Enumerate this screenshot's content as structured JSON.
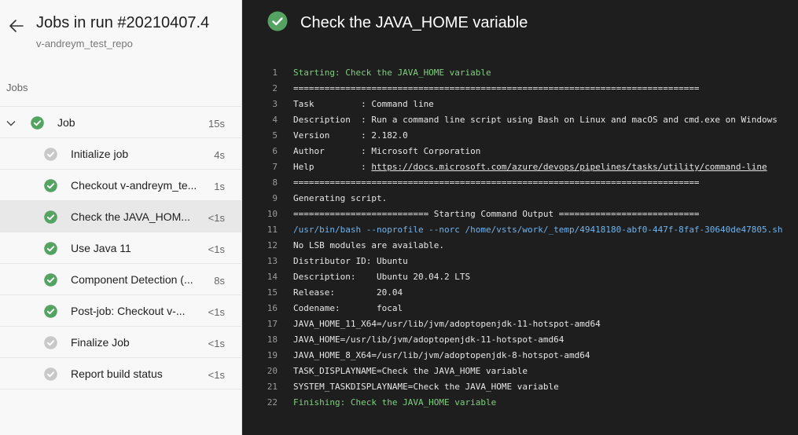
{
  "left_panel": {
    "title": "Jobs in run #20210407.4",
    "repo": "v-andreym_test_repo",
    "section_label": "Jobs",
    "job": {
      "label": "Job",
      "duration": "15s",
      "status": "success"
    },
    "steps": [
      {
        "label": "Initialize job",
        "duration": "4s",
        "status": "skipped"
      },
      {
        "label": "Checkout v-andreym_te...",
        "duration": "1s",
        "status": "success"
      },
      {
        "label": "Check the JAVA_HOM...",
        "duration": "<1s",
        "status": "success",
        "selected": true
      },
      {
        "label": "Use Java 11",
        "duration": "<1s",
        "status": "success"
      },
      {
        "label": "Component Detection (...",
        "duration": "8s",
        "status": "success"
      },
      {
        "label": "Post-job: Checkout v-...",
        "duration": "<1s",
        "status": "success"
      },
      {
        "label": "Finalize Job",
        "duration": "<1s",
        "status": "skipped"
      },
      {
        "label": "Report build status",
        "duration": "<1s",
        "status": "skipped"
      }
    ]
  },
  "log_panel": {
    "title": "Check the JAVA_HOME variable",
    "lines": [
      {
        "n": "1",
        "text": "Starting: Check the JAVA_HOME variable",
        "style": "green"
      },
      {
        "n": "2",
        "text": "==============================================================================",
        "style": ""
      },
      {
        "n": "3",
        "text": "Task         : Command line",
        "style": ""
      },
      {
        "n": "4",
        "text": "Description  : Run a command line script using Bash on Linux and macOS and cmd.exe on Windows",
        "style": ""
      },
      {
        "n": "5",
        "text": "Version      : 2.182.0",
        "style": ""
      },
      {
        "n": "6",
        "text": "Author       : Microsoft Corporation",
        "style": ""
      },
      {
        "n": "7",
        "prefix": "Help         : ",
        "link": "https://docs.microsoft.com/azure/devops/pipelines/tasks/utility/command-line",
        "style": ""
      },
      {
        "n": "8",
        "text": "==============================================================================",
        "style": ""
      },
      {
        "n": "9",
        "text": "Generating script.",
        "style": ""
      },
      {
        "n": "10",
        "text": "========================== Starting Command Output ===========================",
        "style": ""
      },
      {
        "n": "11",
        "text": "/usr/bin/bash --noprofile --norc /home/vsts/work/_temp/49418180-abf0-447f-8faf-30640de47805.sh",
        "style": "blue"
      },
      {
        "n": "12",
        "text": "No LSB modules are available.",
        "style": ""
      },
      {
        "n": "13",
        "text": "Distributor ID: Ubuntu",
        "style": ""
      },
      {
        "n": "14",
        "text": "Description:    Ubuntu 20.04.2 LTS",
        "style": ""
      },
      {
        "n": "15",
        "text": "Release:        20.04",
        "style": ""
      },
      {
        "n": "16",
        "text": "Codename:       focal",
        "style": ""
      },
      {
        "n": "17",
        "text": "JAVA_HOME_11_X64=/usr/lib/jvm/adoptopenjdk-11-hotspot-amd64",
        "style": ""
      },
      {
        "n": "18",
        "text": "JAVA_HOME=/usr/lib/jvm/adoptopenjdk-11-hotspot-amd64",
        "style": ""
      },
      {
        "n": "19",
        "text": "JAVA_HOME_8_X64=/usr/lib/jvm/adoptopenjdk-8-hotspot-amd64",
        "style": ""
      },
      {
        "n": "20",
        "text": "TASK_DISPLAYNAME=Check the JAVA_HOME variable",
        "style": ""
      },
      {
        "n": "21",
        "text": "SYSTEM_TASKDISPLAYNAME=Check the JAVA_HOME variable",
        "style": ""
      },
      {
        "n": "22",
        "text": "Finishing: Check the JAVA_HOME variable",
        "style": "green"
      }
    ]
  },
  "colors": {
    "success": "#55a362",
    "skipped": "#c8c8c8",
    "log_bg": "#1e1e1e",
    "log_green": "#7fcf7f",
    "log_blue": "#6fb4ee"
  },
  "icons": {
    "back": "arrow-left-icon",
    "expand": "chevron-down-icon",
    "success": "check-circle-icon",
    "skipped": "check-circle-gray-icon"
  }
}
